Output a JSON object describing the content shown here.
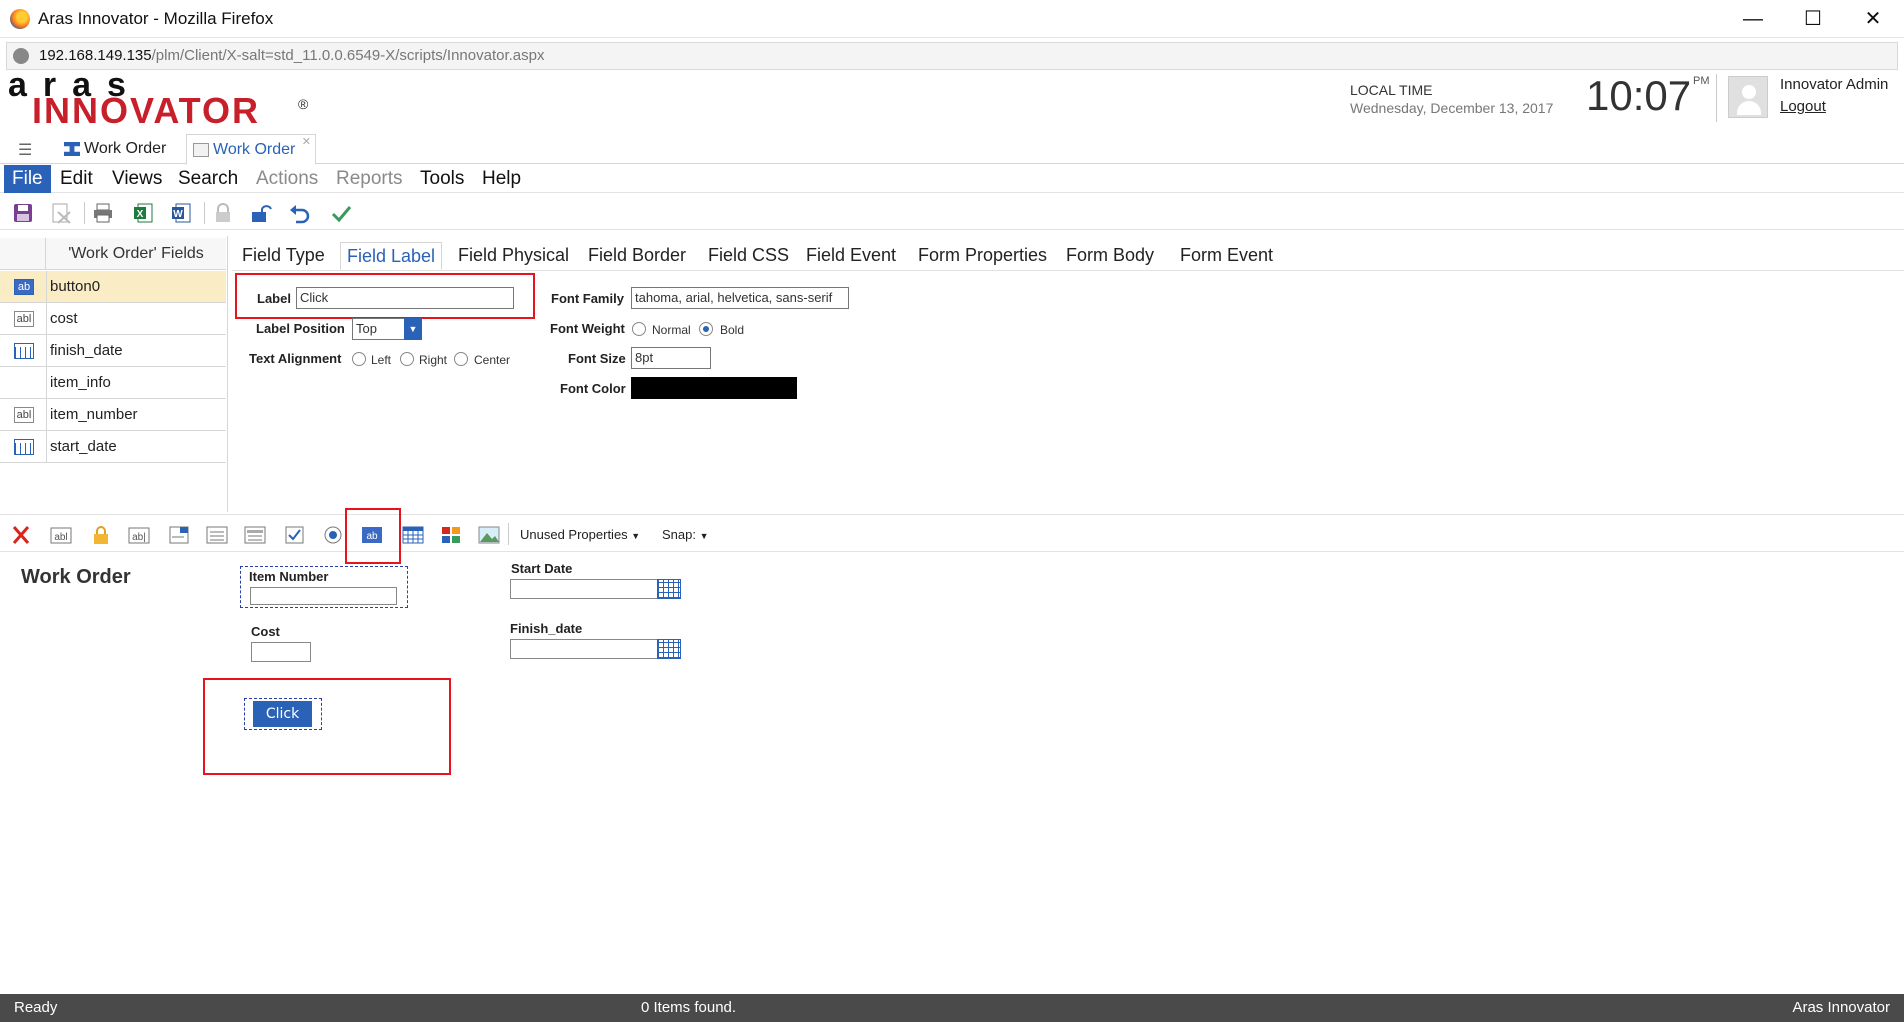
{
  "window": {
    "title": "Aras Innovator - Mozilla Firefox",
    "url_host": "192.168.149.135",
    "url_path": "/plm/Client/X-salt=std_11.0.0.6549-X/scripts/Innovator.aspx",
    "controls": [
      "—",
      "☐",
      "✕"
    ]
  },
  "header": {
    "logo_top": "aras",
    "logo_main": "INNOVATOR",
    "logo_reg": "®",
    "local_time_label": "LOCAL TIME",
    "local_date": "Wednesday, December 13, 2017",
    "clock": "10:07",
    "ampm": "PM",
    "user_name": "Innovator Admin",
    "logout": "Logout"
  },
  "tabs": [
    {
      "label": "Work Order",
      "active": false
    },
    {
      "label": "Work Order",
      "active": true
    }
  ],
  "menu": [
    {
      "label": "File",
      "state": "active"
    },
    {
      "label": "Edit",
      "state": "normal"
    },
    {
      "label": "Views",
      "state": "normal"
    },
    {
      "label": "Search",
      "state": "normal"
    },
    {
      "label": "Actions",
      "state": "disabled"
    },
    {
      "label": "Reports",
      "state": "disabled"
    },
    {
      "label": "Tools",
      "state": "normal"
    },
    {
      "label": "Help",
      "state": "normal"
    }
  ],
  "toolbar_icons": [
    "save-icon",
    "discard-icon",
    "print-icon",
    "excel-icon",
    "word-icon",
    "lock-icon",
    "unlock-icon",
    "undo-icon",
    "done-icon"
  ],
  "fields_panel": {
    "header": "'Work Order' Fields",
    "items": [
      {
        "name": "button0",
        "icon": "ab",
        "selected": true
      },
      {
        "name": "cost",
        "icon": "abl",
        "selected": false
      },
      {
        "name": "finish_date",
        "icon": "date",
        "selected": false
      },
      {
        "name": "item_info",
        "icon": "",
        "selected": false
      },
      {
        "name": "item_number",
        "icon": "abl",
        "selected": false
      },
      {
        "name": "start_date",
        "icon": "date",
        "selected": false
      }
    ]
  },
  "property_tabs": [
    "Field Type",
    "Field Label",
    "Field Physical",
    "Field Border",
    "Field CSS",
    "Field Event",
    "Form Properties",
    "Form Body",
    "Form Event"
  ],
  "field_label": {
    "label_caption": "Label",
    "label_value": "Click",
    "label_position_caption": "Label Position",
    "label_position_value": "Top",
    "text_alignment_caption": "Text Alignment",
    "align_options": [
      "Left",
      "Right",
      "Center"
    ],
    "font_family_caption": "Font Family",
    "font_family_value": "tahoma, arial, helvetica, sans-serif",
    "font_weight_caption": "Font Weight",
    "weight_options": [
      "Normal",
      "Bold"
    ],
    "weight_selected": "Bold",
    "font_size_caption": "Font Size",
    "font_size_value": "8pt",
    "font_color_caption": "Font Color",
    "font_color_value": "#000000"
  },
  "editor_toolbar": {
    "unused_properties": "Unused Properties",
    "snap": "Snap:"
  },
  "form_canvas": {
    "title": "Work Order",
    "item_number_label": "Item Number",
    "cost_label": "Cost",
    "start_date_label": "Start Date",
    "finish_date_label": "Finish_date",
    "button_label": "Click"
  },
  "status": {
    "left": "Ready",
    "center": "0 Items found.",
    "right": "Aras Innovator"
  },
  "colors": {
    "accent": "#2a62b8",
    "highlight_red": "#e8141c",
    "selected_row": "#faecc4",
    "status_bar": "#4a4a4a"
  }
}
